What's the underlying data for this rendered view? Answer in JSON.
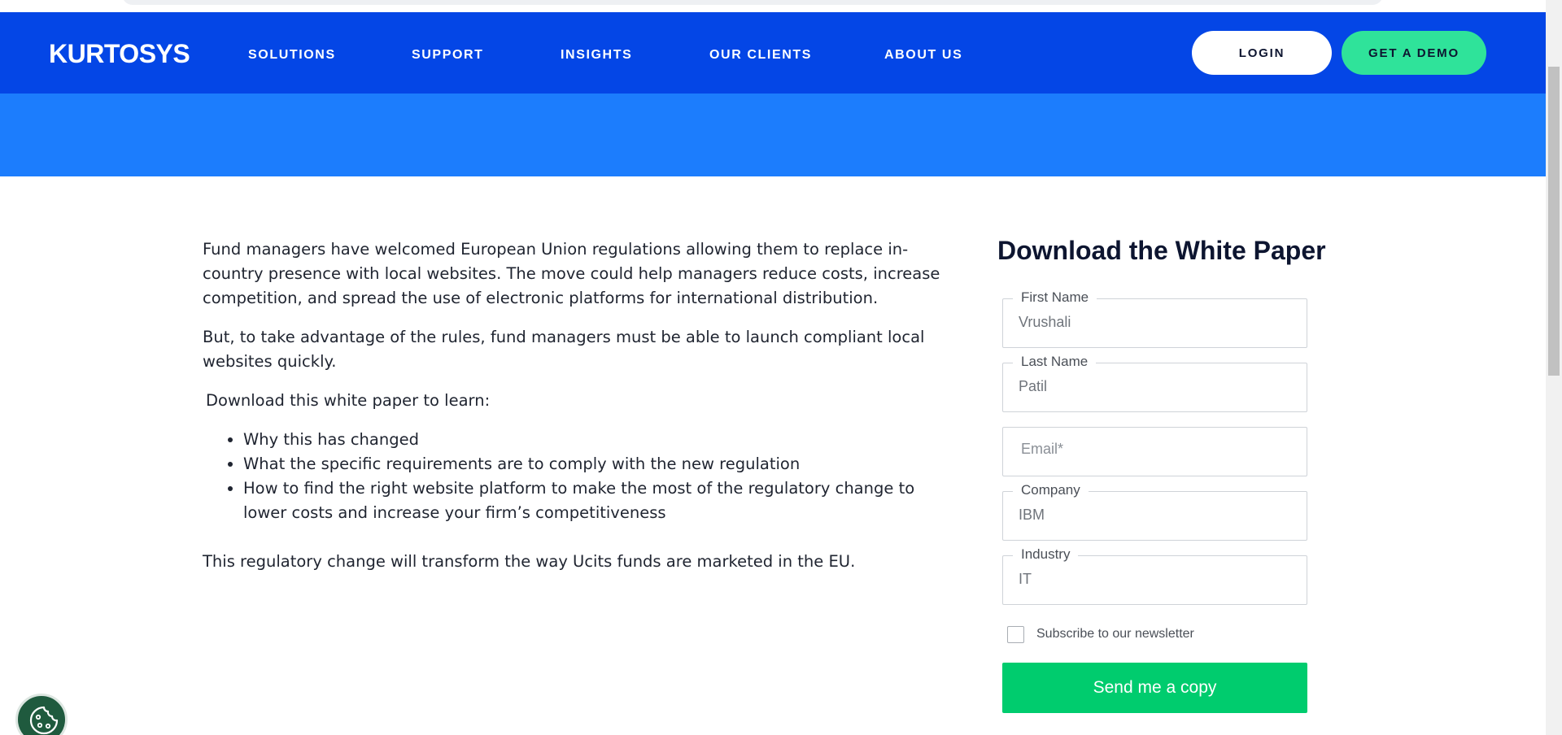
{
  "header": {
    "logo": "KURTOSYS",
    "nav": [
      "SOLUTIONS",
      "SUPPORT",
      "INSIGHTS",
      "OUR CLIENTS",
      "ABOUT US"
    ],
    "login_label": "LOGIN",
    "demo_label": "GET A DEMO"
  },
  "article": {
    "p1": "Fund managers have welcomed European Union regulations allowing them to replace in-country presence with local websites. The move could help managers reduce costs, increase competition, and spread the use of electronic platforms for international distribution.",
    "p2": "But, to take advantage of the rules, fund managers must be able to launch compliant local websites quickly.",
    "intro": "Download this white paper to learn:",
    "bullets": [
      "Why this has changed",
      "What the specific requirements are to comply with the new regulation",
      "How to find the right website platform to make the most of the regulatory change to lower costs and increase your firm’s competitiveness"
    ],
    "closing": "This regulatory change will transform the way Ucits funds are marketed in the EU."
  },
  "form": {
    "title": "Download the White Paper",
    "fields": {
      "first_name": {
        "label": "First Name",
        "value": "Vrushali"
      },
      "last_name": {
        "label": "Last Name",
        "value": "Patil"
      },
      "email": {
        "placeholder": "Email*"
      },
      "company": {
        "label": "Company",
        "value": "IBM"
      },
      "industry": {
        "label": "Industry",
        "value": "IT"
      }
    },
    "newsletter_label": "Subscribe to our newsletter",
    "submit_label": "Send me a copy"
  },
  "colors": {
    "nav_bg": "#0446e6",
    "hero_bg": "#1c7dfd",
    "demo_button": "#2fe39a",
    "submit_button": "#00cc6e",
    "cookie_bg": "#1f5a3e"
  },
  "icons": {
    "cookie": "cookie-icon"
  }
}
